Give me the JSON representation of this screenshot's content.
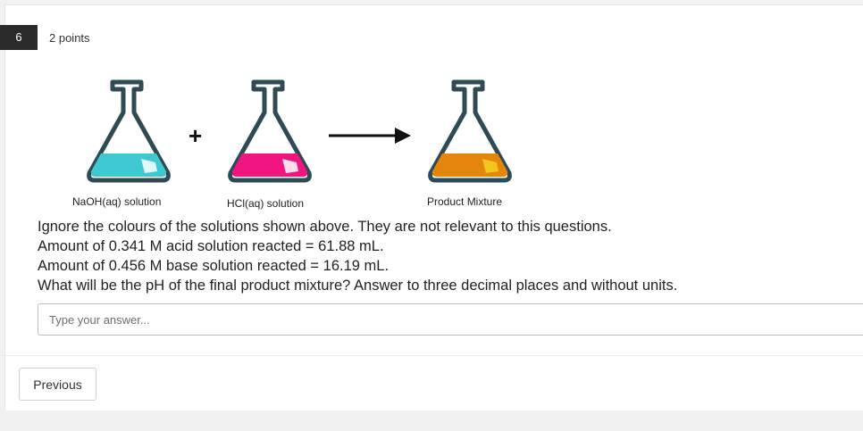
{
  "question": {
    "number": "6",
    "points": "2 points"
  },
  "figure": {
    "flask_labels": [
      "NaOH(aq) solution",
      "HCl(aq) solution",
      "Product Mixture"
    ],
    "plus_symbol": "+",
    "colors": {
      "naoh_liquid": "#3ec8cf",
      "hcl_liquid": "#f0157f",
      "product_liquid": "#e4860c",
      "product_highlight": "#f4c51c",
      "flask_outline": "#2d4a55"
    }
  },
  "body": {
    "lines": [
      "Ignore the colours of the solutions shown above. They are not relevant to this questions.",
      "Amount of 0.341 M acid solution reacted = 61.88 mL.",
      "Amount of 0.456 M base solution reacted = 16.19 mL.",
      "What will be the pH of the final product mixture? Answer to three decimal places and without units."
    ]
  },
  "answer": {
    "placeholder": "Type your answer..."
  },
  "nav": {
    "previous_label": "Previous"
  }
}
